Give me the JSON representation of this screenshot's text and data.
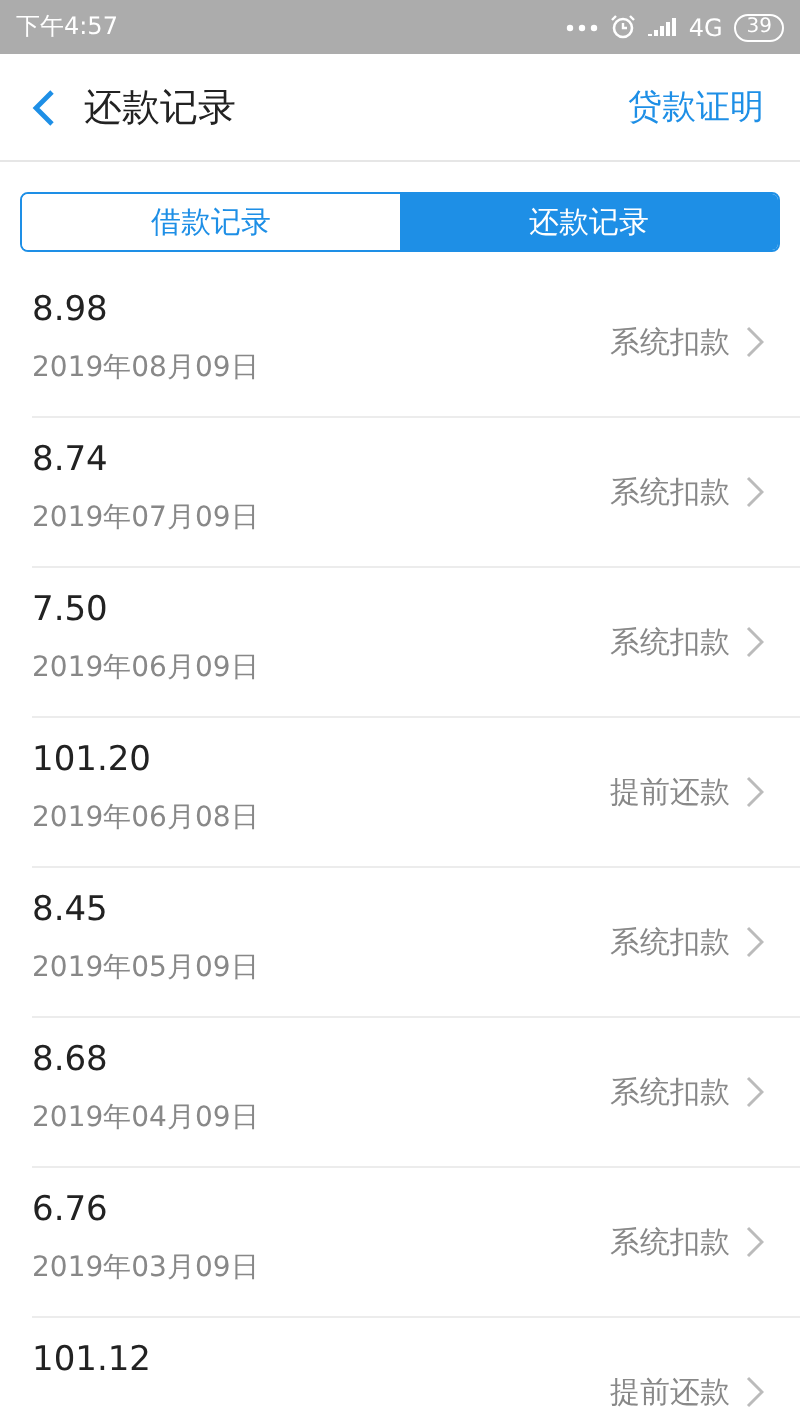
{
  "status_bar": {
    "time": "下午4:57",
    "network": "4G",
    "battery": "39"
  },
  "header": {
    "title": "还款记录",
    "action": "贷款证明"
  },
  "tabs": [
    {
      "label": "借款记录",
      "selected": false
    },
    {
      "label": "还款记录",
      "selected": true
    }
  ],
  "records": [
    {
      "amount": "8.98",
      "date": "2019年08月09日",
      "type": "系统扣款"
    },
    {
      "amount": "8.74",
      "date": "2019年07月09日",
      "type": "系统扣款"
    },
    {
      "amount": "7.50",
      "date": "2019年06月09日",
      "type": "系统扣款"
    },
    {
      "amount": "101.20",
      "date": "2019年06月08日",
      "type": "提前还款"
    },
    {
      "amount": "8.45",
      "date": "2019年05月09日",
      "type": "系统扣款"
    },
    {
      "amount": "8.68",
      "date": "2019年04月09日",
      "type": "系统扣款"
    },
    {
      "amount": "6.76",
      "date": "2019年03月09日",
      "type": "系统扣款"
    },
    {
      "amount": "101.12",
      "type": "提前还款"
    }
  ]
}
